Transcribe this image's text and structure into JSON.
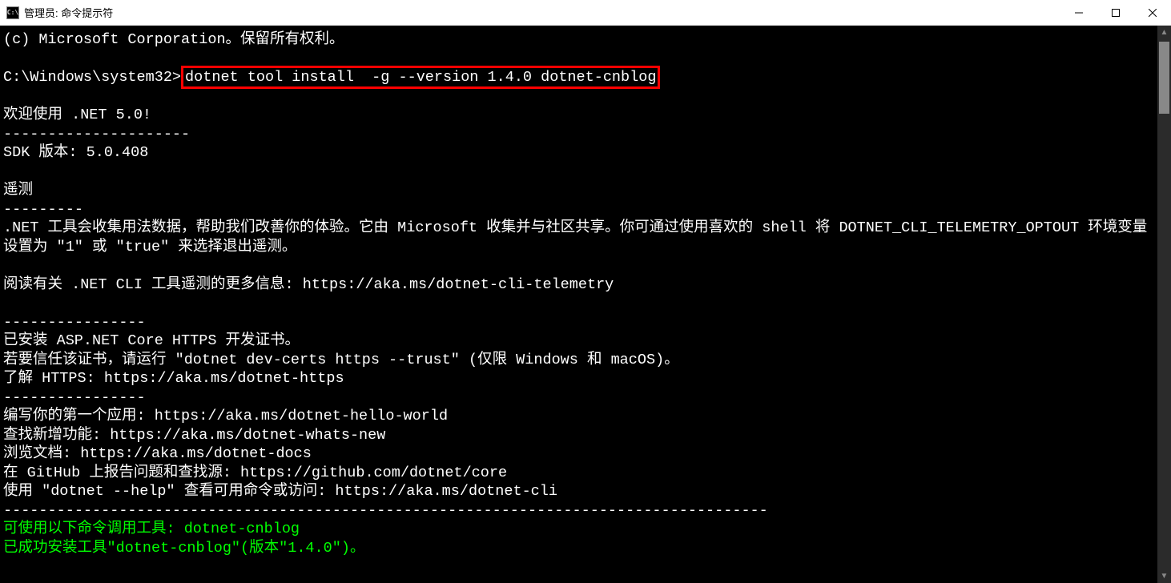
{
  "titlebar": {
    "icon_text": "C:\\",
    "title": "管理员: 命令提示符"
  },
  "terminal": {
    "lines": [
      {
        "text": "(c) Microsoft Corporation。保留所有权利。",
        "type": "normal"
      },
      {
        "text": "",
        "type": "normal"
      },
      {
        "prompt": "C:\\Windows\\system32>",
        "command": "dotnet tool install  -g --version 1.4.0 dotnet-cnblog",
        "type": "command-highlight"
      },
      {
        "text": "",
        "type": "normal"
      },
      {
        "text": "欢迎使用 .NET 5.0!",
        "type": "normal"
      },
      {
        "text": "---------------------",
        "type": "normal"
      },
      {
        "text": "SDK 版本: 5.0.408",
        "type": "normal"
      },
      {
        "text": "",
        "type": "normal"
      },
      {
        "text": "遥测",
        "type": "normal"
      },
      {
        "text": "---------",
        "type": "normal"
      },
      {
        "text": ".NET 工具会收集用法数据，帮助我们改善你的体验。它由 Microsoft 收集并与社区共享。你可通过使用喜欢的 shell 将 DOTNET_CLI_TELEMETRY_OPTOUT 环境变量设置为 \"1\" 或 \"true\" 来选择退出遥测。",
        "type": "normal"
      },
      {
        "text": "",
        "type": "normal"
      },
      {
        "text": "阅读有关 .NET CLI 工具遥测的更多信息: https://aka.ms/dotnet-cli-telemetry",
        "type": "normal"
      },
      {
        "text": "",
        "type": "normal"
      },
      {
        "text": "----------------",
        "type": "normal"
      },
      {
        "text": "已安装 ASP.NET Core HTTPS 开发证书。",
        "type": "normal"
      },
      {
        "text": "若要信任该证书，请运行 \"dotnet dev-certs https --trust\" (仅限 Windows 和 macOS)。",
        "type": "normal"
      },
      {
        "text": "了解 HTTPS: https://aka.ms/dotnet-https",
        "type": "normal"
      },
      {
        "text": "----------------",
        "type": "normal"
      },
      {
        "text": "编写你的第一个应用: https://aka.ms/dotnet-hello-world",
        "type": "normal"
      },
      {
        "text": "查找新增功能: https://aka.ms/dotnet-whats-new",
        "type": "normal"
      },
      {
        "text": "浏览文档: https://aka.ms/dotnet-docs",
        "type": "normal"
      },
      {
        "text": "在 GitHub 上报告问题和查找源: https://github.com/dotnet/core",
        "type": "normal"
      },
      {
        "text": "使用 \"dotnet --help\" 查看可用命令或访问: https://aka.ms/dotnet-cli",
        "type": "normal"
      },
      {
        "text": "--------------------------------------------------------------------------------------",
        "type": "normal"
      },
      {
        "text": "可使用以下命令调用工具: dotnet-cnblog",
        "type": "green"
      },
      {
        "text": "已成功安装工具\"dotnet-cnblog\"(版本\"1.4.0\")。",
        "type": "green"
      }
    ]
  }
}
